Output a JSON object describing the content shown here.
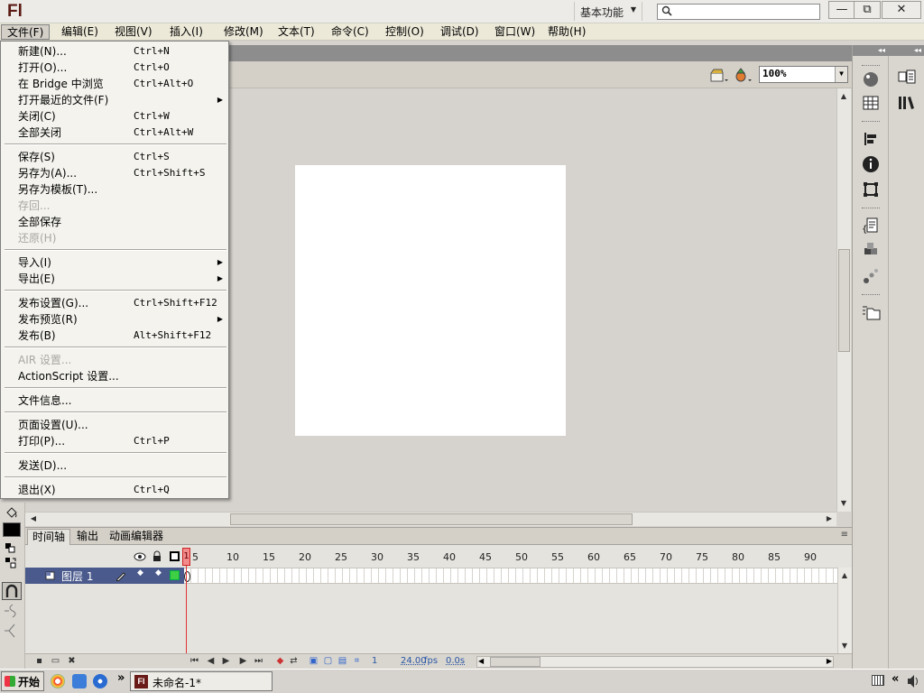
{
  "app": {
    "logo": "Fl"
  },
  "titlebar": {
    "workspace": "基本功能",
    "search_placeholder": "",
    "minimize": "—",
    "restore": "⧉",
    "close": "✕"
  },
  "menubar": [
    "文件(F)",
    "编辑(E)",
    "视图(V)",
    "插入(I)",
    "修改(M)",
    "文本(T)",
    "命令(C)",
    "控制(O)",
    "调试(D)",
    "窗口(W)",
    "帮助(H)"
  ],
  "file_menu": [
    {
      "label": "新建(N)...",
      "shortcut": "Ctrl+N"
    },
    {
      "label": "打开(O)...",
      "shortcut": "Ctrl+O"
    },
    {
      "label": "在 Bridge 中浏览",
      "shortcut": "Ctrl+Alt+O"
    },
    {
      "label": "打开最近的文件(F)",
      "submenu": true
    },
    {
      "label": "关闭(C)",
      "shortcut": "Ctrl+W"
    },
    {
      "label": "全部关闭",
      "shortcut": "Ctrl+Alt+W"
    },
    {
      "label": "保存(S)",
      "shortcut": "Ctrl+S"
    },
    {
      "label": "另存为(A)...",
      "shortcut": "Ctrl+Shift+S"
    },
    {
      "label": "另存为模板(T)..."
    },
    {
      "label": "存回...",
      "disabled": true
    },
    {
      "label": "全部保存"
    },
    {
      "label": "还原(H)",
      "disabled": true
    },
    {
      "label": "导入(I)",
      "submenu": true
    },
    {
      "label": "导出(E)",
      "submenu": true
    },
    {
      "label": "发布设置(G)...",
      "shortcut": "Ctrl+Shift+F12"
    },
    {
      "label": "发布预览(R)",
      "submenu": true
    },
    {
      "label": "发布(B)",
      "shortcut": "Alt+Shift+F12"
    },
    {
      "label": "AIR 设置...",
      "disabled": true
    },
    {
      "label": "ActionScript 设置..."
    },
    {
      "label": "文件信息..."
    },
    {
      "label": "页面设置(U)..."
    },
    {
      "label": "打印(P)...",
      "shortcut": "Ctrl+P"
    },
    {
      "label": "发送(D)..."
    },
    {
      "label": "退出(X)",
      "shortcut": "Ctrl+Q"
    }
  ],
  "zoom": "100%",
  "timeline": {
    "tabs": [
      "时间轴",
      "输出",
      "动画编辑器"
    ],
    "frame_numbers": [
      "1",
      "5",
      "10",
      "15",
      "20",
      "25",
      "30",
      "35",
      "40",
      "45",
      "50",
      "55",
      "60",
      "65",
      "70",
      "75",
      "80",
      "85",
      "90"
    ],
    "layer_name": "图层 1",
    "current_frame": "1",
    "fps": "24.00",
    "fps_unit": "fps",
    "time": "0.0s"
  },
  "taskbar": {
    "start": "开始",
    "task": "未命名-1*",
    "chevron": "»"
  }
}
